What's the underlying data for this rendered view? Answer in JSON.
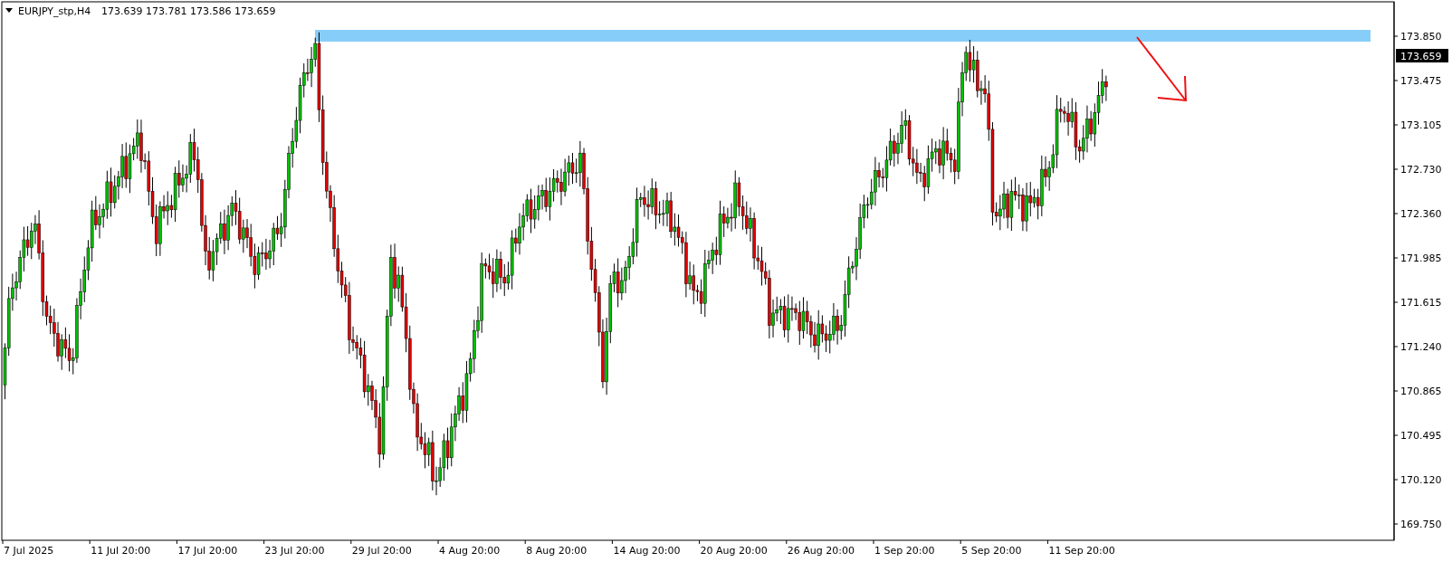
{
  "chart": {
    "symbol": "EURJPY_stp,H4",
    "ohlc": "173.639 173.781 173.586 173.659",
    "price_label": "173.659",
    "y_axis_labels": [
      "173.850",
      "173.475",
      "173.105",
      "172.730",
      "172.360",
      "171.985",
      "171.615",
      "171.240",
      "170.865",
      "170.495",
      "170.120",
      "169.750"
    ],
    "x_axis_labels": [
      "7 Jul 2025",
      "11 Jul 20:00",
      "17 Jul 20:00",
      "23 Jul 20:00",
      "29 Jul 20:00",
      "4 Aug 20:00",
      "8 Aug 20:00",
      "14 Aug 20:00",
      "20 Aug 20:00",
      "26 Aug 20:00",
      "1 Sep 20:00",
      "5 Sep 20:00",
      "11 Sep 20:00"
    ]
  }
}
